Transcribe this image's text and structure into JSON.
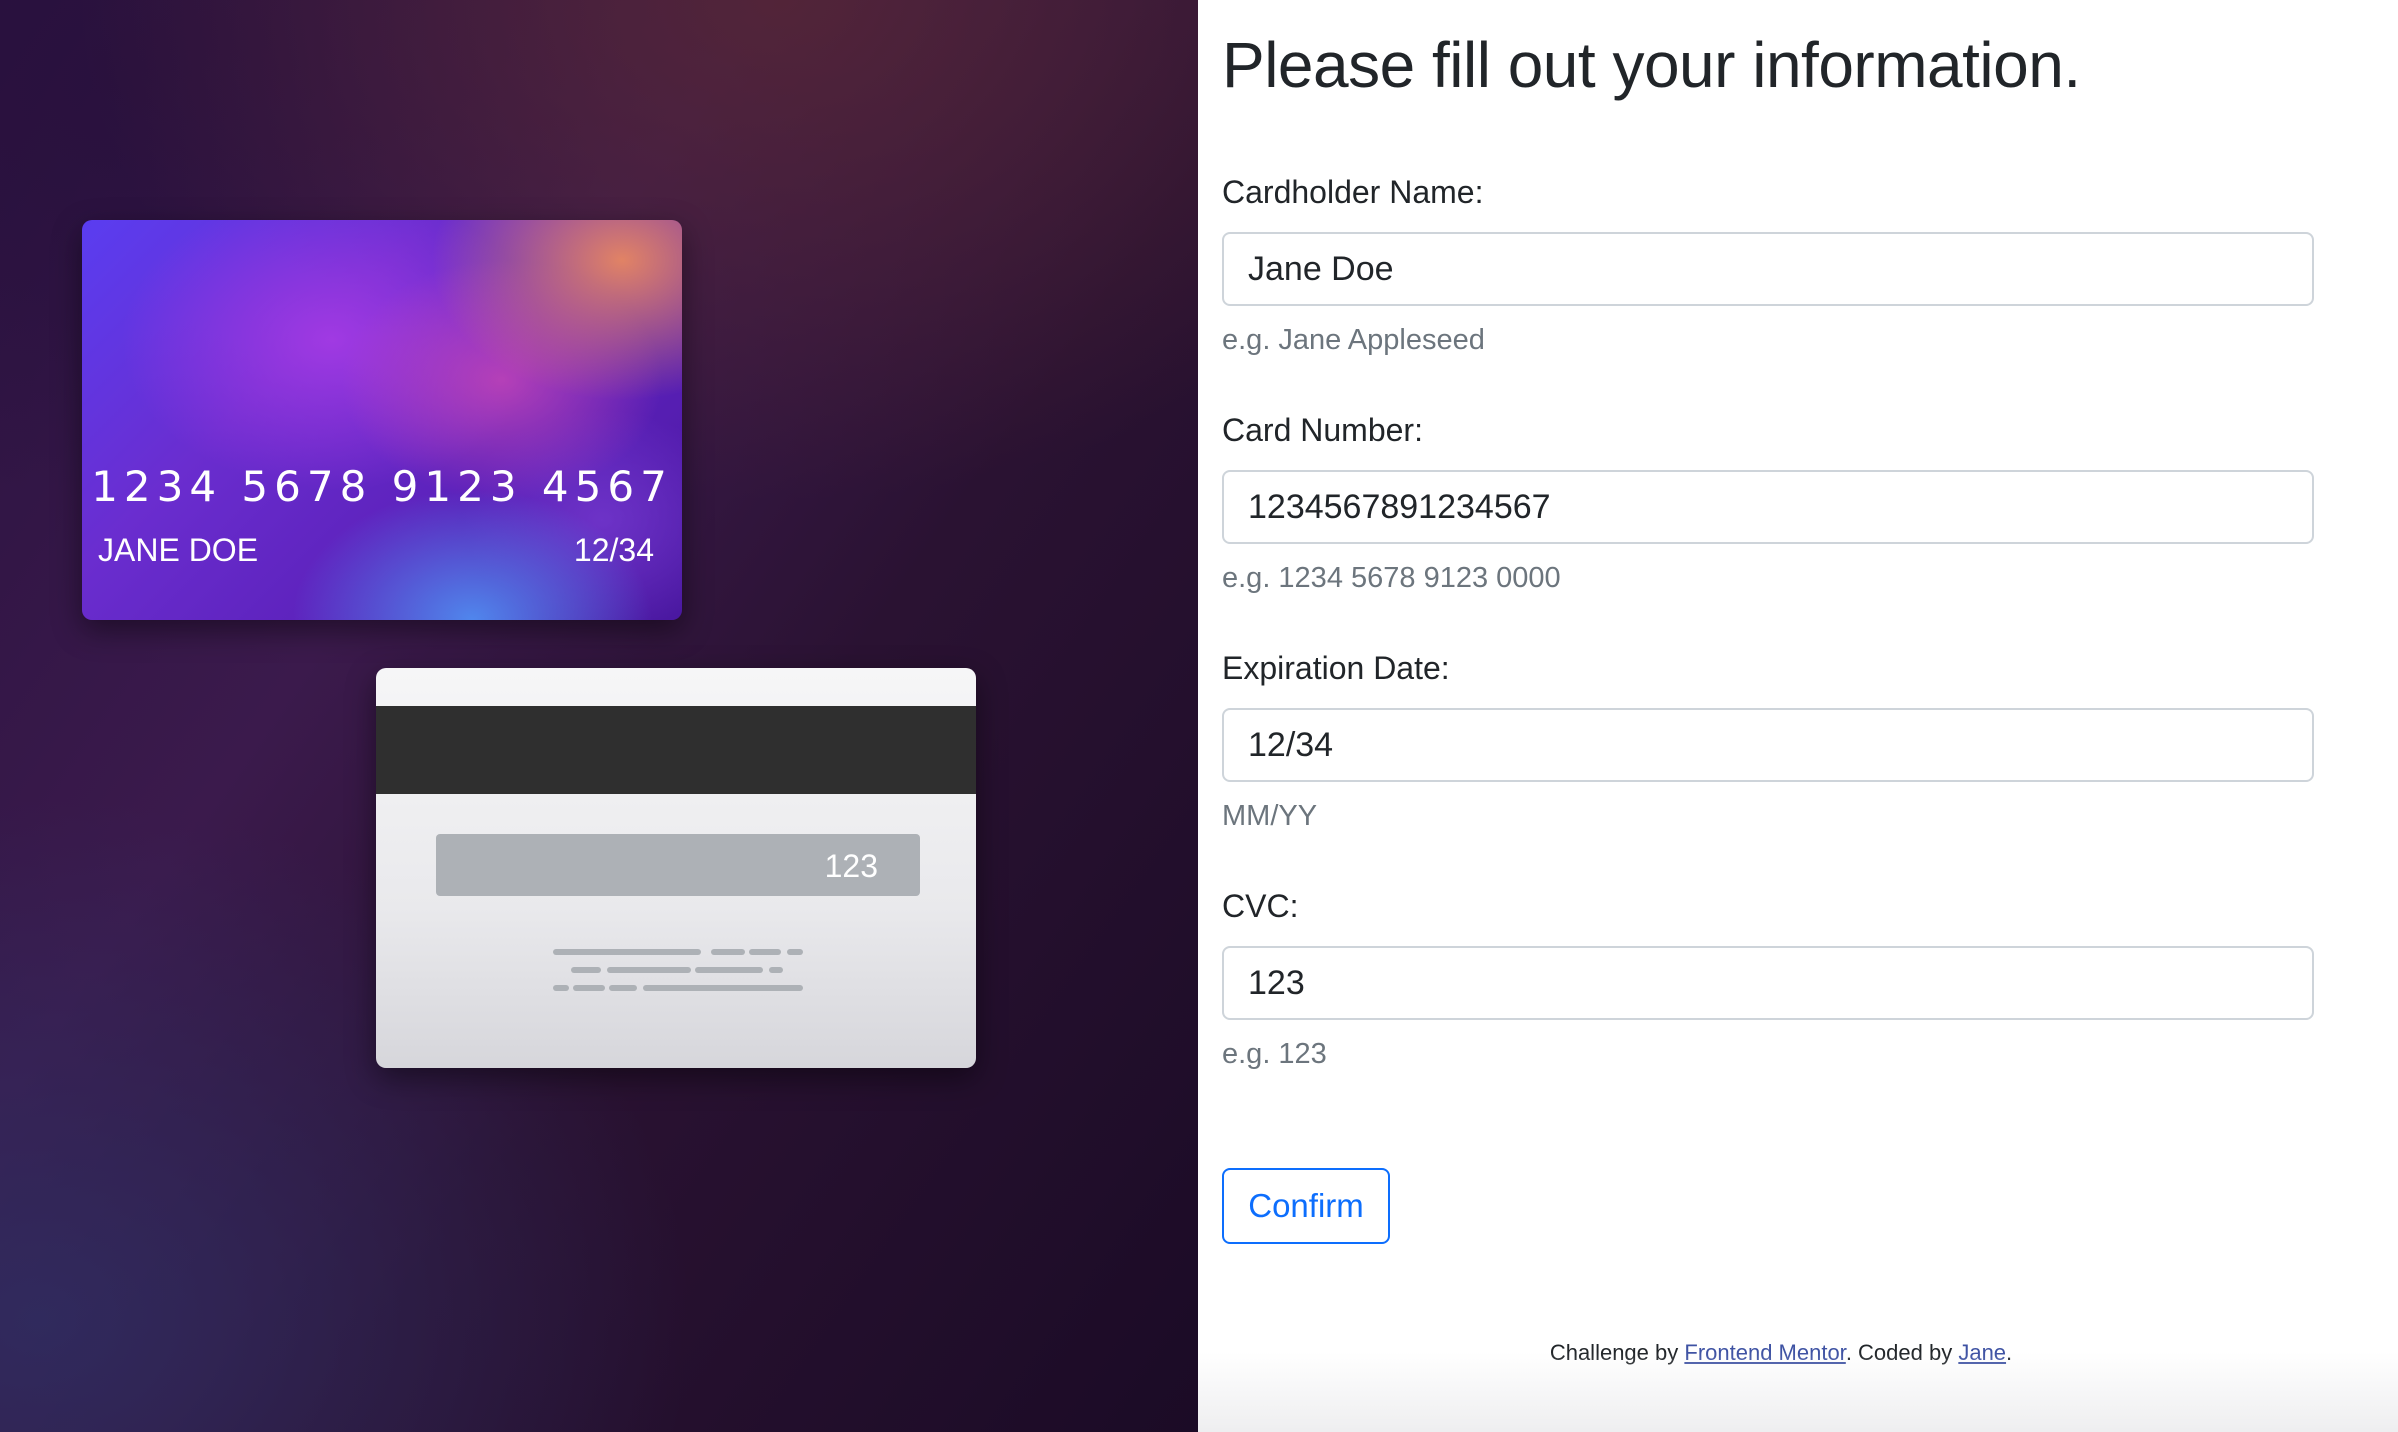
{
  "card_front": {
    "number": "1234 5678 9123 4567",
    "name": "JANE DOE",
    "expiry": "12/34"
  },
  "card_back": {
    "cvc": "123"
  },
  "form": {
    "title": "Please fill out your information.",
    "fields": [
      {
        "label": "Cardholder Name:",
        "value": "Jane Doe",
        "help": "e.g. Jane Appleseed"
      },
      {
        "label": "Card Number:",
        "value": "1234567891234567",
        "help": "e.g. 1234 5678 9123 0000"
      },
      {
        "label": "Expiration Date:",
        "value": "12/34",
        "help": "MM/YY"
      },
      {
        "label": "CVC:",
        "value": "123",
        "help": "e.g. 123"
      }
    ],
    "confirm_label": "Confirm"
  },
  "footer": {
    "prefix": "Challenge by ",
    "link1": "Frontend Mentor",
    "middle": ". Coded by ",
    "link2": "Jane",
    "suffix": "."
  },
  "colors": {
    "accent": "#0d6efd",
    "help_text": "#6c757d",
    "link": "#3e52a3"
  }
}
